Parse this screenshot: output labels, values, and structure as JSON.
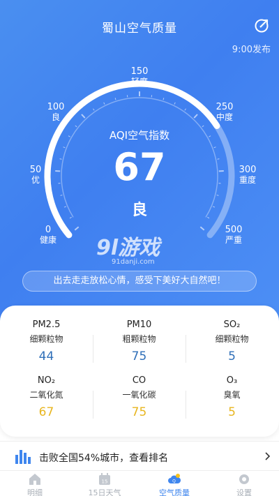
{
  "header": {
    "title": "蜀山空气质量",
    "publish_time": "9:00发布"
  },
  "gauge": {
    "scale": [
      {
        "value": "0",
        "label": "健康"
      },
      {
        "value": "50",
        "label": "优"
      },
      {
        "value": "100",
        "label": "良"
      },
      {
        "value": "150",
        "label": "轻度"
      },
      {
        "value": "250",
        "label": "中度"
      },
      {
        "value": "300",
        "label": "重度"
      },
      {
        "value": "500",
        "label": "严重"
      }
    ],
    "title": "AQI空气指数",
    "value": "67",
    "level": "良",
    "max": 500,
    "current": 67
  },
  "watermark": {
    "logo": "9l游戏",
    "site": "91danji.com"
  },
  "tip": "出去走走放松心情，感受下美好大自然吧！",
  "pollutants": [
    {
      "name": "PM2.5",
      "desc": "细颗粒物",
      "value": "44",
      "color": "#2f6fb8"
    },
    {
      "name": "PM10",
      "desc": "粗颗粒物",
      "value": "75",
      "color": "#2f6fb8"
    },
    {
      "name": "SO₂",
      "desc": "细颗粒物",
      "value": "5",
      "color": "#2f6fb8"
    },
    {
      "name": "NO₂",
      "desc": "二氧化氮",
      "value": "67",
      "color": "#e8b620"
    },
    {
      "name": "CO",
      "desc": "一氧化碳",
      "value": "75",
      "color": "#e8b620"
    },
    {
      "name": "O₃",
      "desc": "臭氧",
      "value": "5",
      "color": "#e8b620"
    }
  ],
  "ranking": {
    "text": "击败全国54%城市，查看排名"
  },
  "nav": [
    {
      "label": "明细",
      "icon": "home-icon"
    },
    {
      "label": "15日天气",
      "icon": "calendar-icon"
    },
    {
      "label": "空气质量",
      "icon": "air-quality-icon",
      "active": true
    },
    {
      "label": "设置",
      "icon": "settings-icon"
    }
  ],
  "colors": {
    "accent": "#3f86ee",
    "good": "#2f6fb8",
    "moderate": "#e8b620"
  }
}
